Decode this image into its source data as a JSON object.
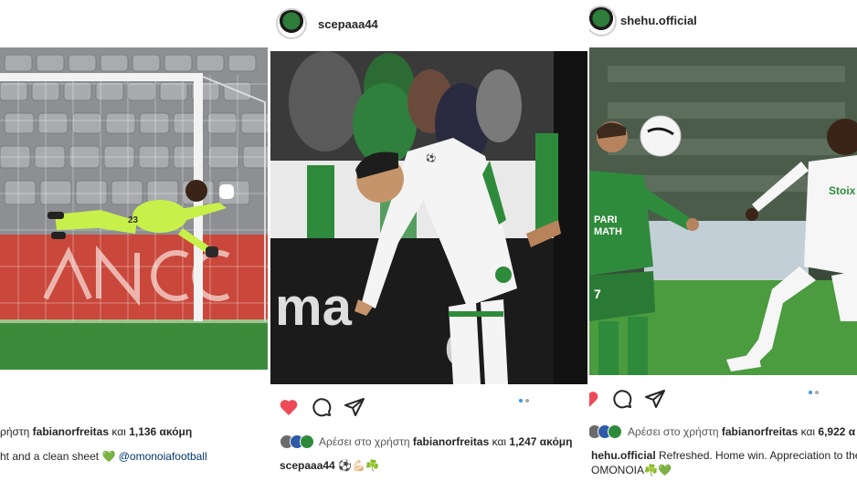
{
  "posts": [
    {
      "id": "left",
      "likes_prefix": "ρήστη",
      "likes_user": "fabianorfreitas",
      "likes_mid": "και",
      "likes_count": "1,136 ακόμη",
      "caption_text": "ht and a clean sheet",
      "caption_heart": "💚",
      "caption_mention": "@omonoiafootball"
    },
    {
      "id": "mid",
      "username": "scepaaa44",
      "likes_prefix": "Αρέσει στο χρήστη",
      "likes_user": "fabianorfreitas",
      "likes_mid": "και",
      "likes_count": "1,247 ακόμη",
      "caption_user": "scepaaa44",
      "caption_emojis": "⚽💪🏻☘️"
    },
    {
      "id": "right",
      "username": "shehu.official",
      "likes_prefix": "Αρέσει στο χρήστη",
      "likes_user": "fabianorfreitas",
      "likes_mid": "και",
      "likes_count": "6,922 α",
      "caption_user": "hehu.official",
      "caption_text": "Refreshed. Home win. Appreciation to the",
      "caption_line2": "OMONOIA☘️💚"
    }
  ],
  "colors": {
    "heart_red": "#ed4956",
    "omonoia_green": "#2e8b3a",
    "dot_active": "#3897f0"
  },
  "icons": [
    "heart-icon",
    "comment-icon",
    "share-icon"
  ]
}
